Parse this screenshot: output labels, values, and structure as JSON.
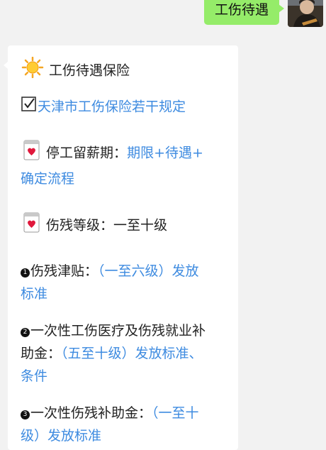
{
  "outgoing": {
    "text": "工伤待遇"
  },
  "incoming": {
    "title": "工伤待遇保险",
    "link1": "天津市工伤保险若干规定",
    "item1_label": "停工留薪期：",
    "item1_link_a": "期限+待遇+",
    "item1_link_b": "确定流程",
    "item2_label": "伤残等级：一至十级",
    "b1_num": "1",
    "b1_label": "伤残津贴：",
    "b1_link_a": "（一至六级）发放",
    "b1_link_b": "标准",
    "b2_num": "2",
    "b2_label_a": "一次性工伤医疗及伤残就业补",
    "b2_label_b": "助金：",
    "b2_link_a": "（五至十级）发放标准、",
    "b2_link_b": "条件",
    "b3_num": "3",
    "b3_label": "一次性伤残补助金：",
    "b3_link_a": "（一至十",
    "b3_link_b": "级）发放标准"
  },
  "icons": {
    "title_icon": "sun-icon",
    "link_icon": "checkbox-icon",
    "item_icon": "calendar-heart-icon"
  },
  "colors": {
    "outgoing_bubble": "#95ec69",
    "link": "#3e8be0",
    "background": "#f2f2f2"
  }
}
